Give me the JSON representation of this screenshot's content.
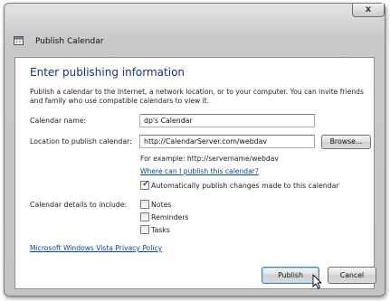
{
  "window": {
    "title": "Publish Calendar",
    "close_glyph": "x"
  },
  "dialog": {
    "heading": "Enter publishing information",
    "intro": "Publish a calendar to the Internet, a network location, or to your computer. You can invite friends and family who use compatible calendars to view it.",
    "calendar_name_label": "Calendar name:",
    "calendar_name_value": "dp's Calendar",
    "location_label": "Location to publish calendar:",
    "location_value": "http://CalendarServer.com/webdav",
    "browse_label": "Browse...",
    "example_text": "For example: http://servername/webdav",
    "where_link": "Where can I publish this calendar?",
    "auto_publish": {
      "label": "Automatically publish changes made to this calendar",
      "checked": true
    },
    "details_label": "Calendar details to include:",
    "details_options": [
      {
        "label": "Notes",
        "checked": false
      },
      {
        "label": "Reminders",
        "checked": false
      },
      {
        "label": "Tasks",
        "checked": false
      }
    ],
    "privacy_link": "Microsoft Windows Vista Privacy Policy"
  },
  "footer": {
    "publish_label": "Publish",
    "cancel_label": "Cancel"
  },
  "icons": {
    "app": "calendar-icon",
    "cursor": "mouse-pointer-icon"
  }
}
